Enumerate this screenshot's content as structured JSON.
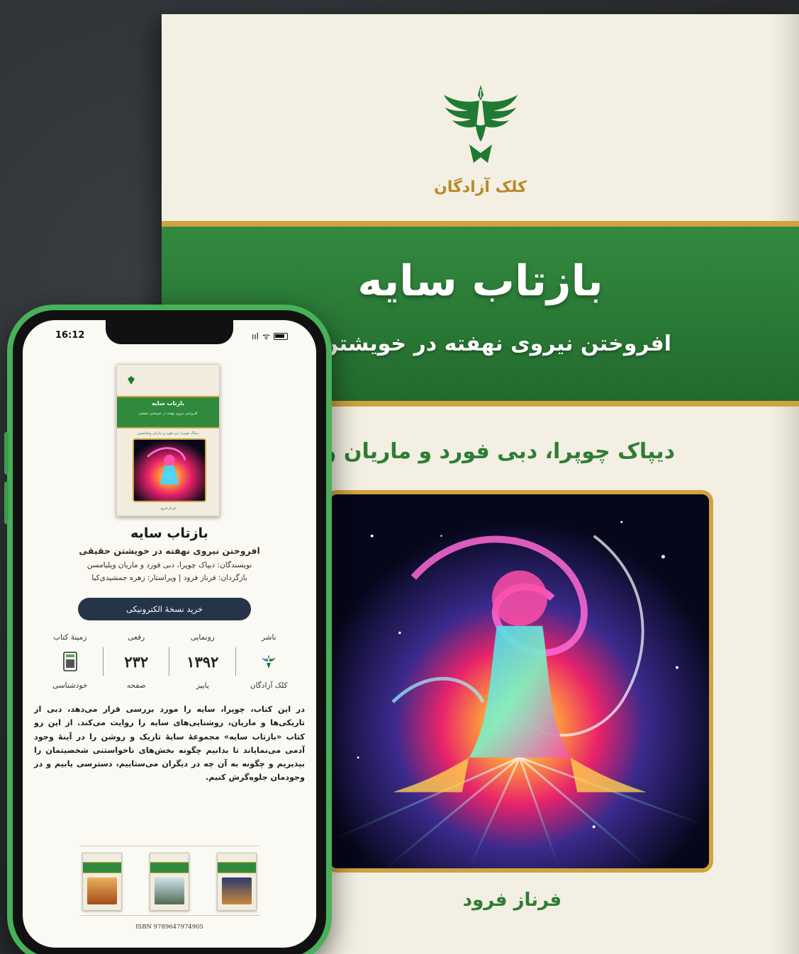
{
  "cover": {
    "publisher": "کلک آزادگان",
    "title": "بازتاب سایه",
    "subtitle": "افروختن نیروی نهفته در خویشتن حق",
    "authors": "دیپاک چوپرا، دبی فورد و ماریان ویلیا",
    "translator": "فرناز فرود"
  },
  "phone": {
    "status_time": "16:12",
    "status_signal": "ııl",
    "status_wifi": "ᯤ",
    "mini_cover": {
      "title": "بازتاب سایه",
      "subtitle": "افروختن نیروی نهفته در خویشتن حقیقی",
      "authors": "دیپاک چوپرا، دبی فورد و ماریان ویلیامسن",
      "translator": "فرناز فرود"
    },
    "book_title": "بازتاب سایه",
    "book_subtitle": "افروختن نیروی نهفته در خویشتن حقیقی",
    "authors_line": "نویسندگان: دیپاک چوپرا، دبی فورد و ماریان ویلیامسن",
    "credits_line": "بازگردان: فرناز فرود | ویراستار: زهره جمشیدی‌کیا",
    "buy_button": "خرید نسخهٔ الکترونیکی",
    "stats": [
      {
        "label": "ناشر",
        "value": "",
        "sub": "کلک آزادگان",
        "kind": "logo"
      },
      {
        "label": "رونمایی",
        "value": "۱۳۹۲",
        "sub": "پاییز",
        "kind": "text"
      },
      {
        "label": "رقعی",
        "value": "۲۳۲",
        "sub": "صفحه",
        "kind": "text"
      },
      {
        "label": "زمینهٔ کتاب",
        "value": "",
        "sub": "خودشناسی",
        "kind": "icon"
      }
    ],
    "description": "در این کتاب، چوپرا، سایه را مورد بررسی قرار می‌دهد، دبی از تاریکی‌ها و ماریان، روشنایی‌های سایه را روایت می‌کند. از این رو کتاب «بازتاب سایه» مجموعهٔ سایهٔ تاریک و روشن را در آینهٔ وجود آدمی می‌نمایاند تا بدانیم چگونه بخش‌های ناخواستنی شخصیتمان را بپذیریم و چگونه به آن چه در دیگران می‌ستاییم، دسترسی یابیم و در وجودمان جلوه‌گرش کنیم.",
    "isbn": "ISBN 9789647974905"
  },
  "colors": {
    "background": "#2b2e31",
    "cover_paper": "#f3efe2",
    "brand_green": "#2f8a3c",
    "gold": "#d0a341",
    "phone_frame": "#49b05a",
    "button": "#26344a"
  }
}
